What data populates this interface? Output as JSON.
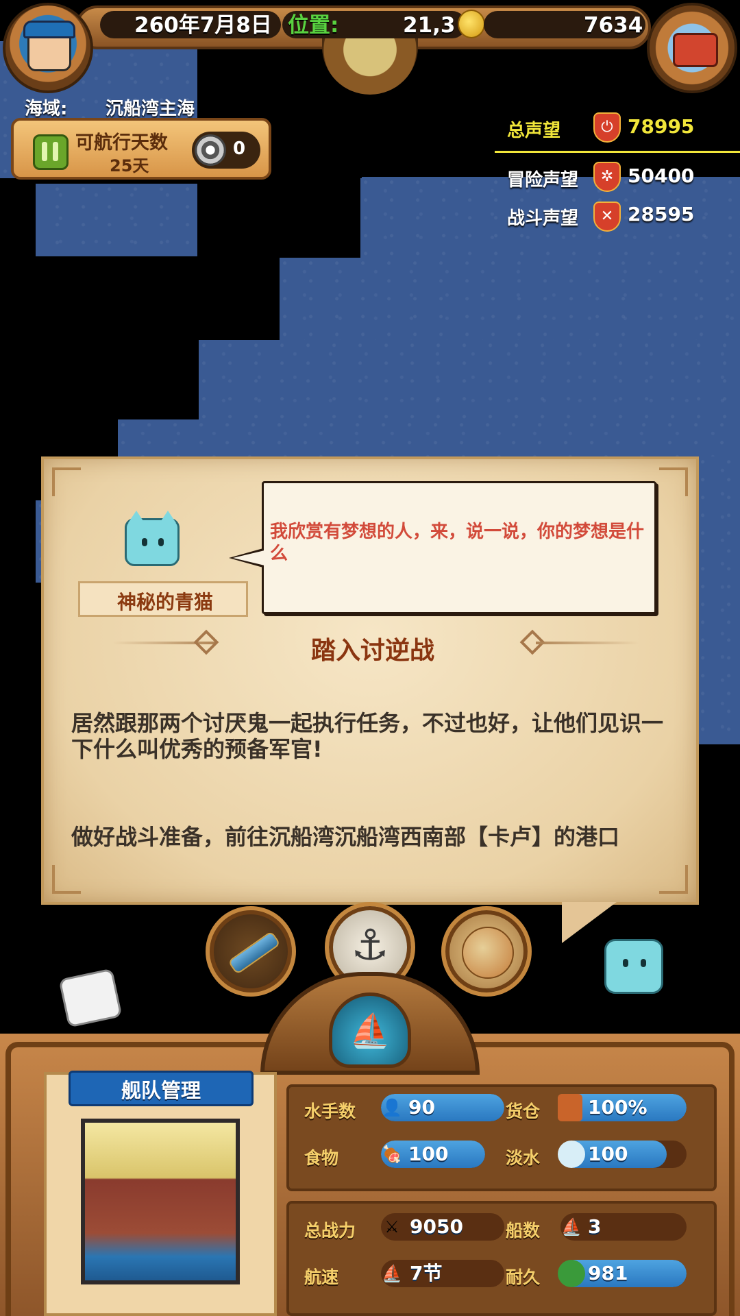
{
  "topbar": {
    "date": "260年7月8日",
    "position_label": "位置:",
    "position_value": "21,3",
    "gold": "7634"
  },
  "sea": {
    "label": "海域:",
    "name": "沉船湾主海"
  },
  "voyage": {
    "title": "可航行天数",
    "days": "25天",
    "counter": "0"
  },
  "reputation": {
    "total_label": "总声望",
    "total_value": "78995",
    "adventure_label": "冒险声望",
    "adventure_value": "50400",
    "battle_label": "战斗声望",
    "battle_value": "28595"
  },
  "dialog": {
    "npc_name": "神秘的青猫",
    "speech": "我欣赏有梦想的人，来，说一说，你的梦想是什么",
    "quest_title": "踏入讨逆战",
    "paragraph1": "居然跟那两个讨厌鬼一起执行任务，不过也好，让他们见识一下什么叫优秀的预备军官!",
    "paragraph2": "做好战斗准备，前往沉船湾沉船湾西南部【卡卢】的港口"
  },
  "fleet": {
    "title": "舰队管理"
  },
  "stats": {
    "sailors_label": "水手数",
    "sailors_value": "90",
    "cargo_label": "货仓",
    "cargo_value": "100%",
    "food_label": "食物",
    "food_value": "100",
    "water_label": "淡水",
    "water_value": "100",
    "power_label": "总战力",
    "power_value": "9050",
    "ships_label": "船数",
    "ships_value": "3",
    "speed_label": "航速",
    "speed_value": "7节",
    "durability_label": "耐久",
    "durability_value": "981"
  },
  "colors": {
    "sea": "#3a5a93",
    "accent_gold": "#f1e63a",
    "quest_text": "#3a3128",
    "speech_text": "#d24a3a",
    "bar_blue": "#2a78c0"
  },
  "icons": {
    "avatar": "pirate-avatar-icon",
    "chest": "treasure-chest-icon",
    "coin": "gold-coin-icon",
    "telescope": "telescope-icon",
    "anchor": "anchor-icon",
    "map": "world-map-icon",
    "ship": "ship-icon"
  }
}
